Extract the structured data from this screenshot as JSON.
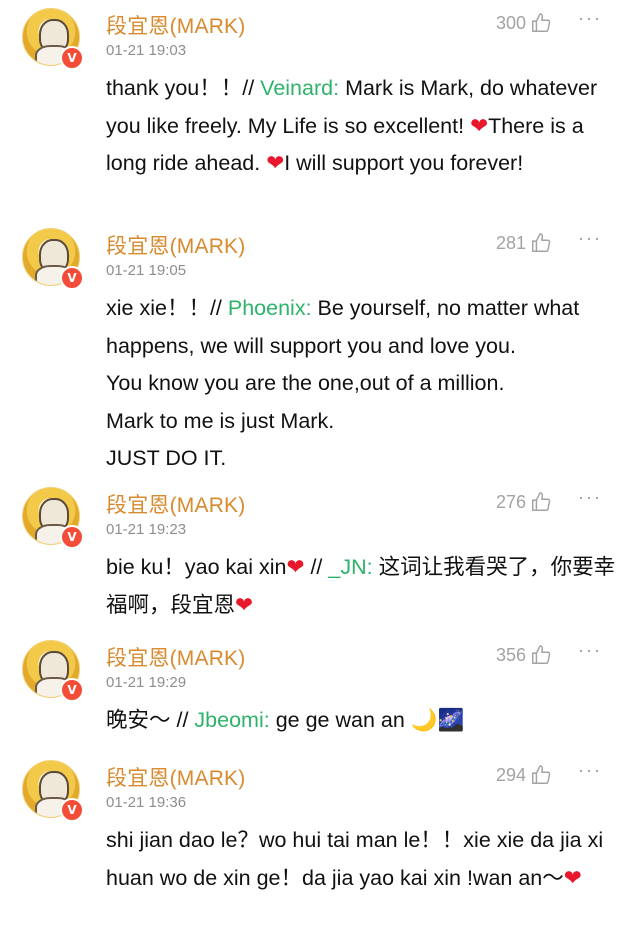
{
  "comments": [
    {
      "username": "段宜恩(MARK)",
      "time": "01-21 19:03",
      "likes": "300",
      "reply": "thank you！！//",
      "mention": "Veinard:",
      "quote": "Mark is Mark, do whatever you like freely. My Life is so excellent! ❤There is a long ride ahead. ❤I will support you forever!"
    },
    {
      "username": "段宜恩(MARK)",
      "time": "01-21 19:05",
      "likes": "281",
      "reply": "xie xie！！//",
      "mention": "Phoenix:",
      "quote": "Be yourself, no matter what happens, we will support you and love you.\nYou know you are the one,out of a million.\nMark to me is just Mark.\nJUST DO IT."
    },
    {
      "username": "段宜恩(MARK)",
      "time": "01-21 19:23",
      "likes": "276",
      "reply": "bie ku！yao kai xin❤ //",
      "mention": "_JN:",
      "quote": "这词让我看哭了，你要幸福啊，段宜恩❤"
    },
    {
      "username": "段宜恩(MARK)",
      "time": "01-21 19:29",
      "likes": "356",
      "reply": "晚安～ //",
      "mention": "Jbeomi:",
      "quote": "ge ge wan an 🌙🌌"
    },
    {
      "username": "段宜恩(MARK)",
      "time": "01-21 19:36",
      "likes": "294",
      "reply": "shi jian dao le？wo hui tai man le！！xie xie da jia xi huan wo de xin ge！da jia yao kai xin !wan an～❤",
      "mention": "",
      "quote": ""
    }
  ],
  "icons": {
    "like": "thumbs-up-icon",
    "more": "more-dots-icon",
    "verified": "verified-v-badge"
  },
  "colors": {
    "username": "#d88a2e",
    "mention": "#2eb36b",
    "heart": "#e8182c",
    "verified_badge": "#f34c38"
  },
  "badge_label": "V",
  "more_glyph": "···"
}
